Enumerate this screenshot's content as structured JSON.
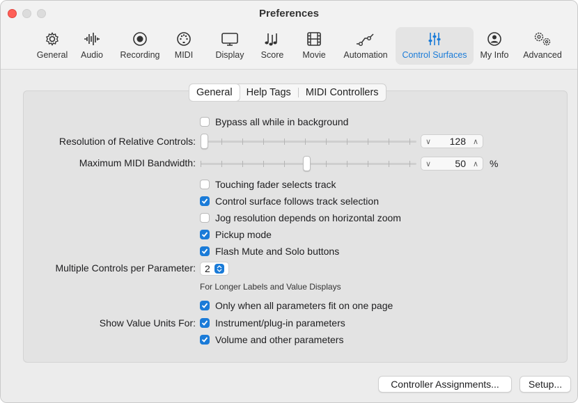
{
  "window": {
    "title": "Preferences"
  },
  "toolbar": {
    "tabs": [
      {
        "label": "General",
        "icon": "gear-icon"
      },
      {
        "label": "Audio",
        "icon": "waveform-icon"
      },
      {
        "label": "Recording",
        "icon": "record-icon"
      },
      {
        "label": "MIDI",
        "icon": "midi-icon"
      },
      {
        "label": "Display",
        "icon": "display-icon"
      },
      {
        "label": "Score",
        "icon": "score-icon"
      },
      {
        "label": "Movie",
        "icon": "film-icon"
      },
      {
        "label": "Automation",
        "icon": "automation-icon"
      },
      {
        "label": "Control Surfaces",
        "icon": "sliders-icon",
        "active": true
      },
      {
        "label": "My Info",
        "icon": "person-icon"
      },
      {
        "label": "Advanced",
        "icon": "advanced-gears-icon"
      }
    ]
  },
  "segments": [
    "General",
    "Help Tags",
    "MIDI Controllers"
  ],
  "settings": {
    "bypass": "Bypass all while in background",
    "resolution_label": "Resolution of Relative Controls:",
    "resolution_value": "128",
    "bandwidth_label": "Maximum MIDI Bandwidth:",
    "bandwidth_value": "50",
    "bandwidth_unit": "%",
    "touching": "Touching fader selects track",
    "follows": "Control surface follows track selection",
    "jog": "Jog resolution depends on horizontal zoom",
    "pickup": "Pickup mode",
    "flash": "Flash Mute and Solo buttons",
    "multiple_label": "Multiple Controls per Parameter:",
    "multiple_value": "2",
    "longer_note": "For Longer Labels and Value Displays",
    "only_when": "Only when all parameters fit on one page",
    "show_units_label": "Show Value Units For:",
    "instrument": "Instrument/plug-in parameters",
    "volume": "Volume and other parameters"
  },
  "buttons": {
    "controller_assignments": "Controller Assignments...",
    "setup": "Setup..."
  },
  "colors": {
    "accent": "#1a7bd8",
    "close": "#fe5f57"
  }
}
